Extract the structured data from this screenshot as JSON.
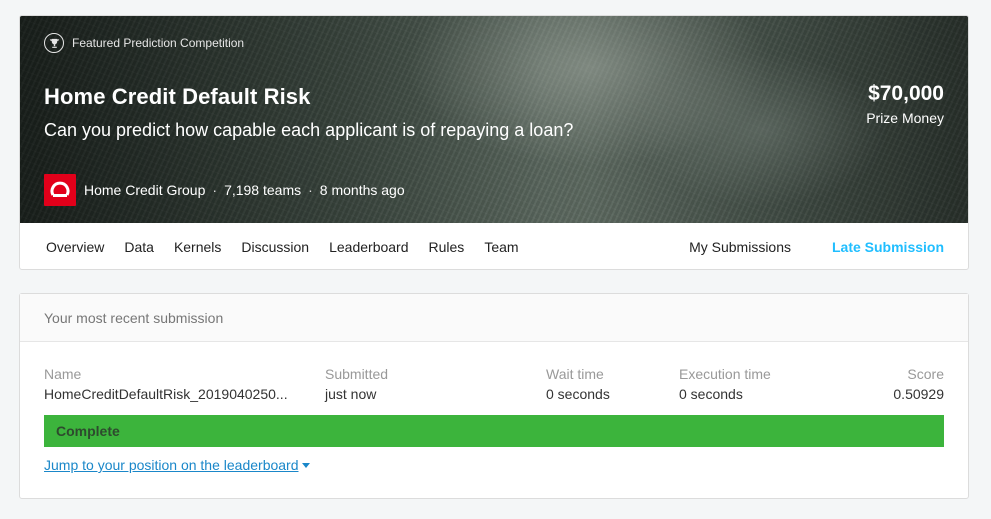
{
  "competition": {
    "badge": "Featured Prediction Competition",
    "title": "Home Credit Default Risk",
    "subtitle": "Can you predict how capable each applicant is of repaying a loan?",
    "prize_amount": "$70,000",
    "prize_label": "Prize Money",
    "host": "Home Credit Group",
    "teams": "7,198 teams",
    "age": "8 months ago",
    "separator": "·",
    "host_logo_color": "#e2001a"
  },
  "tabs": {
    "left": [
      "Overview",
      "Data",
      "Kernels",
      "Discussion",
      "Leaderboard",
      "Rules",
      "Team"
    ],
    "my_submissions": "My Submissions",
    "late_submission": "Late Submission",
    "active_color": "#20beff"
  },
  "submission": {
    "header": "Your most recent submission",
    "columns": {
      "name": "Name",
      "submitted": "Submitted",
      "wait": "Wait time",
      "exec": "Execution time",
      "score": "Score"
    },
    "values": {
      "name": "HomeCreditDefaultRisk_2019040250...",
      "submitted": "just now",
      "wait": "0 seconds",
      "exec": "0 seconds",
      "score": "0.50929"
    },
    "status": "Complete",
    "status_color": "#3cb43c",
    "jump_link": "Jump to your position on the leaderboard"
  }
}
